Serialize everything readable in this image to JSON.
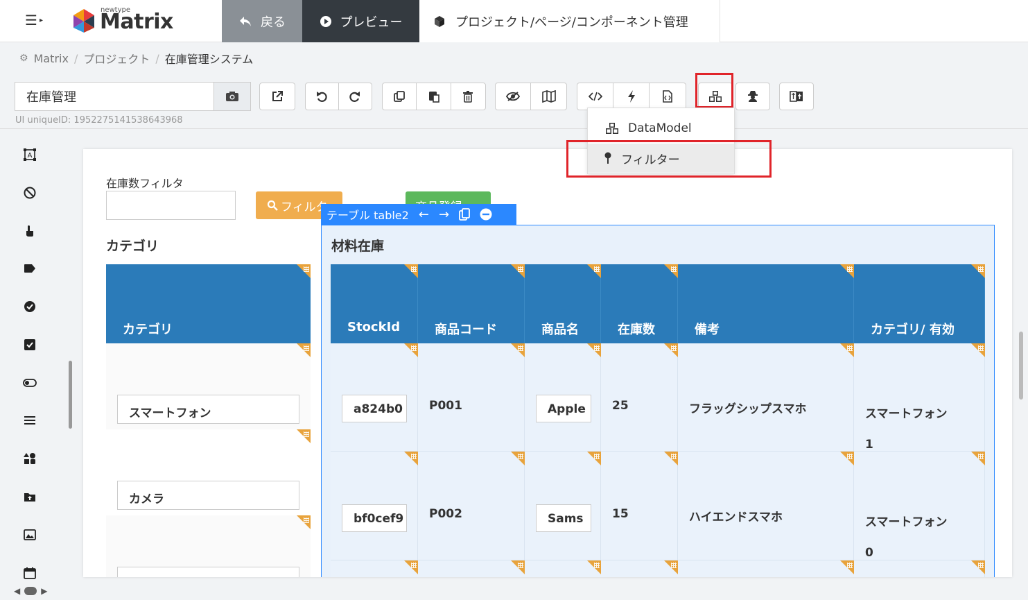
{
  "header": {
    "logo_small": "newtype",
    "logo_text": "Matrix",
    "back_label": "戻る",
    "preview_label": "プレビュー",
    "manage_label": "プロジェクト/ページ/コンポーネント管理"
  },
  "breadcrumb": {
    "items": [
      "Matrix",
      "プロジェクト",
      "在庫管理システム"
    ],
    "separator": "/"
  },
  "toolbar": {
    "name_value": "在庫管理",
    "uid_text": "UI uniqueID: 1952275141538643968"
  },
  "dropdown": {
    "items": [
      {
        "label": "DataModel",
        "icon": "cubes-icon"
      },
      {
        "label": "フィルター",
        "icon": "pin-icon"
      }
    ]
  },
  "canvas": {
    "filter_label": "在庫数フィルタ",
    "filter_btn": "フィルタ",
    "register_btn": "商品登録",
    "category_title": "カテゴリ",
    "category_header": "カテゴリ",
    "category_rows": [
      "スマートフォン",
      "カメラ",
      ""
    ],
    "selection_tab": "テーブル table2",
    "material_title": "材料在庫",
    "table": {
      "headers": [
        "StockId",
        "商品コード",
        "商品名",
        "在庫数",
        "備考",
        "カテゴリ/ 有効"
      ],
      "rows": [
        {
          "stock_id": "a824b0",
          "code": "P001",
          "name": "Apple",
          "qty": "25",
          "note": "フラッグシップスマホ",
          "category": "スマートフォン",
          "active": "1"
        },
        {
          "stock_id": "bf0cef9",
          "code": "P002",
          "name": "Sams",
          "qty": "15",
          "note": "ハイエンドスマホ",
          "category": "スマートフォン",
          "active": "0"
        }
      ]
    }
  },
  "colors": {
    "header_blue": "#2b7bb9",
    "selection_blue": "#2b88ff",
    "highlight_red": "#e0242a",
    "filter_orange": "#f0ad4e",
    "register_green": "#5cb85c"
  }
}
